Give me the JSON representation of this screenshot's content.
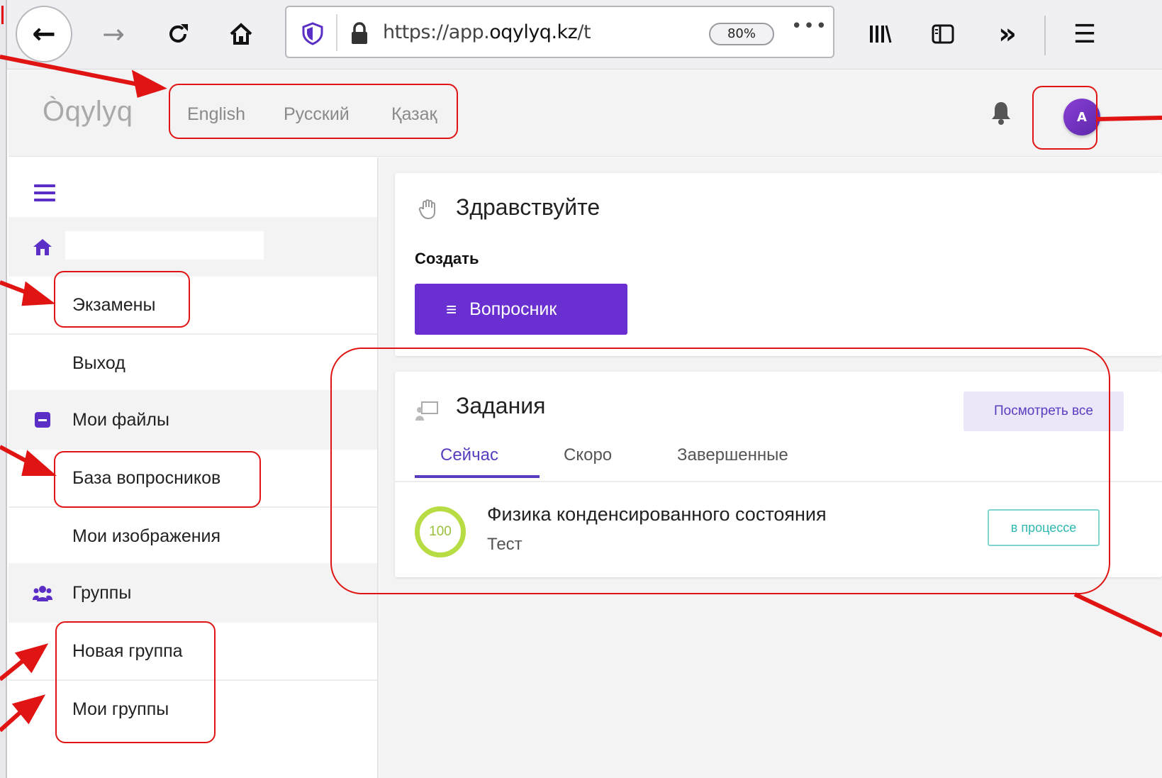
{
  "browser": {
    "url_prefix": "https://app.",
    "url_domain": "oqylyq.kz",
    "url_suffix": "/t",
    "zoom": "80%",
    "url_more": "•••"
  },
  "header": {
    "logo": "Òqylyq",
    "languages": [
      "English",
      "Русский",
      "Қазақ"
    ],
    "avatar_initial": "A"
  },
  "sidebar": {
    "items": [
      {
        "label": "",
        "kind": "section",
        "icon": "home-icon"
      },
      {
        "label": "Экзамены",
        "kind": "item"
      },
      {
        "label": "Выход",
        "kind": "item"
      },
      {
        "label": "Мои файлы",
        "kind": "section",
        "icon": "folder-icon"
      },
      {
        "label": "База вопросников",
        "kind": "item"
      },
      {
        "label": "Мои изображения",
        "kind": "item"
      },
      {
        "label": "Группы",
        "kind": "section",
        "icon": "users-icon"
      },
      {
        "label": "Новая группа",
        "kind": "item"
      },
      {
        "label": "Мои группы",
        "kind": "item"
      }
    ]
  },
  "main": {
    "greeting": "Здравствуйте",
    "create_label": "Создать",
    "quiz_button": "Вопросник",
    "tasks": {
      "title": "Задания",
      "view_all": "Посмотреть все",
      "tabs": [
        "Сейчас",
        "Скоро",
        "Завершенные"
      ],
      "active_tab": "Сейчас",
      "items": [
        {
          "progress": "100",
          "name": "Физика конденсированного состояния",
          "type": "Тест",
          "status": "в процессе"
        }
      ]
    }
  },
  "colors": {
    "accent": "#6a2fd0",
    "annotation": "#e11414",
    "progress": "#b8dc44",
    "status": "#2fb8b0"
  }
}
